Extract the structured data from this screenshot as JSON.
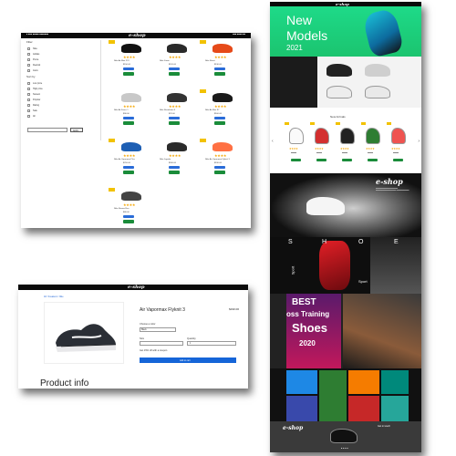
{
  "brand": "e-shop",
  "listing": {
    "filter_title": "Filter",
    "filters_a": [
      "Nike",
      "Adidas",
      "Puma",
      "Reebok",
      "Asics"
    ],
    "sort_title": "Sort by",
    "filters_b": [
      "Low price",
      "High price",
      "Newest",
      "Popular",
      "Rating",
      "Sale",
      "All"
    ],
    "apply": "Apply",
    "product_names": [
      "Nike Air Max 270",
      "Nike Zoom",
      "Nike React",
      "Nike Air Force 1",
      "Nike Revolution 5",
      "Nike Air Max 97",
      "Nike Air Vapormax Plus",
      "Nike Joyride",
      "Nike Air Vapormax Flyknit 3",
      "Nike Renew Run"
    ],
    "prices": [
      "$150.00",
      "$120.00",
      "$130.00",
      "$90.00",
      "$70.00",
      "$160.00",
      "$210.00",
      "$180.00",
      "$190.00",
      "$80.00"
    ],
    "sale_label": "Sale"
  },
  "product": {
    "breadcrumb": "All / Sneakers / Nike",
    "title": "Air Vapormax Flyknit 3",
    "price": "$190.00",
    "color_label": "Choose a color",
    "color_value": "Black",
    "size_label": "Size",
    "quantity_label": "Quantity",
    "quantity_value": "1",
    "note": "Get 15% off with a coupon",
    "add_to_cart": "Add to cart",
    "info_heading": "Product info"
  },
  "landing": {
    "hero_title_1": "New",
    "hero_title_2": "Models",
    "hero_year": "2021",
    "arrivals_title": "New Arrivals",
    "shoe_letters": [
      "S",
      "H",
      "O",
      "E"
    ],
    "sport_labels": [
      "Sport",
      "Sport"
    ],
    "poster_line1": "BEST",
    "poster_line2": "oss Training",
    "poster_line3": "Shoes",
    "poster_year": "2020",
    "footer_right": "Get in touch"
  },
  "colors": {
    "accent_green": "#1fd67f",
    "button_green": "#1a8c3a",
    "button_blue": "#2a6cd8",
    "star": "#f6a600",
    "dark": "#0a0a0a"
  }
}
